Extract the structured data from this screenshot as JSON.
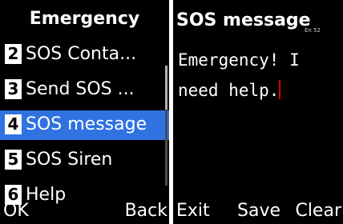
{
  "left_screen": {
    "title": "Emergency",
    "menu_items": [
      {
        "number": "2",
        "label": "SOS Conta..."
      },
      {
        "number": "3",
        "label": "Send SOS ..."
      },
      {
        "number": "4",
        "label": "SOS message",
        "selected": true
      },
      {
        "number": "5",
        "label": "SOS Siren"
      },
      {
        "number": "6",
        "label": "Help"
      }
    ],
    "softkeys": {
      "left": "OK",
      "right": "Back"
    }
  },
  "right_screen": {
    "title": "SOS message",
    "input_mode": "En 52",
    "message_line1": "Emergency! I",
    "message_line2": "need help.",
    "softkeys": {
      "left": "Exit",
      "center": "Save",
      "right": "Clear"
    }
  },
  "colors": {
    "background": "#000000",
    "selection": "#2f72e0",
    "caret": "#e00000",
    "text": "#ffffff"
  }
}
